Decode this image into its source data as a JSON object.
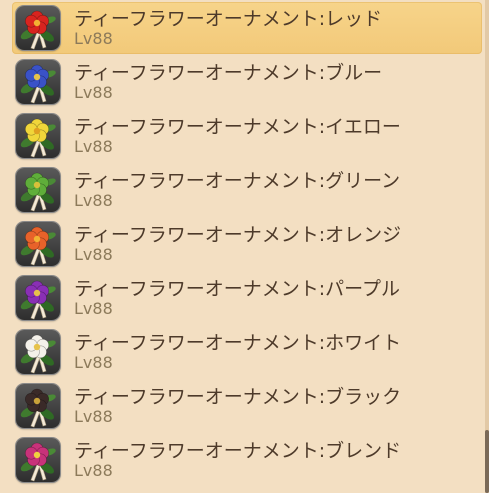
{
  "items": [
    {
      "name": "ティーフラワーオーナメント:レッド",
      "level": "Lv88",
      "color": "#d8241f",
      "center": "#f2b233",
      "selected": true
    },
    {
      "name": "ティーフラワーオーナメント:ブルー",
      "level": "Lv88",
      "color": "#3a52c8",
      "center": "#e6c24a",
      "selected": false
    },
    {
      "name": "ティーフラワーオーナメント:イエロー",
      "level": "Lv88",
      "color": "#f0d63a",
      "center": "#e0a020",
      "selected": false
    },
    {
      "name": "ティーフラワーオーナメント:グリーン",
      "level": "Lv88",
      "color": "#5fae3a",
      "center": "#d8c03a",
      "selected": false
    },
    {
      "name": "ティーフラワーオーナメント:オレンジ",
      "level": "Lv88",
      "color": "#e8622a",
      "center": "#f2b233",
      "selected": false
    },
    {
      "name": "ティーフラワーオーナメント:パープル",
      "level": "Lv88",
      "color": "#8a2fb5",
      "center": "#e6c24a",
      "selected": false
    },
    {
      "name": "ティーフラワーオーナメント:ホワイト",
      "level": "Lv88",
      "color": "#f4f1ea",
      "center": "#e6c24a",
      "selected": false
    },
    {
      "name": "ティーフラワーオーナメント:ブラック",
      "level": "Lv88",
      "color": "#3a2a28",
      "center": "#c9a23a",
      "selected": false
    },
    {
      "name": "ティーフラワーオーナメント:ブレンド",
      "level": "Lv88",
      "color": "#c8327a",
      "center": "#f0d040",
      "selected": false
    }
  ],
  "icon": "flower-ornament-icon"
}
